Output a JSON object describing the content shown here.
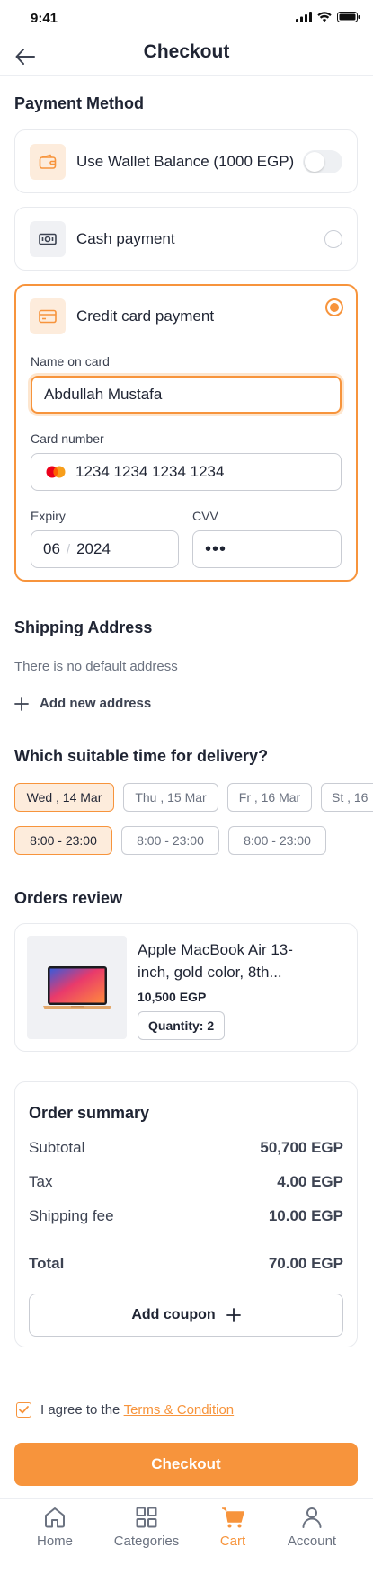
{
  "status": {
    "time": "9:41"
  },
  "header": {
    "title": "Checkout"
  },
  "payment": {
    "title": "Payment Method",
    "wallet_label": "Use Wallet Balance (1000 EGP)",
    "cash_label": "Cash payment",
    "credit_label": "Credit card payment",
    "name_label": "Name on card",
    "name_value": "Abdullah Mustafa",
    "card_label": "Card number",
    "card_value": "1234 1234 1234 1234",
    "expiry_label": "Expiry",
    "expiry_month": "06",
    "expiry_sep": "/",
    "expiry_year": "2024",
    "cvv_label": "CVV",
    "cvv_value": "•••"
  },
  "shipping": {
    "title": "Shipping Address",
    "empty_text": "There is no default address",
    "add_label": "Add new address"
  },
  "delivery": {
    "title": "Which suitable time for delivery?",
    "dates": [
      "Wed , 14 Mar",
      "Thu , 15 Mar",
      "Fr , 16 Mar",
      "St , 16"
    ],
    "times": [
      "8:00 - 23:00",
      "8:00 - 23:00",
      "8:00 - 23:00"
    ]
  },
  "orders": {
    "title": "Orders review",
    "product_name_1": "Apple MacBook Air 13-",
    "product_name_2": "inch, gold color, 8th...",
    "price": "10,500 EGP",
    "quantity": "Quantity: 2"
  },
  "summary": {
    "title": "Order summary",
    "subtotal_label": "Subtotal",
    "subtotal_value": "50,700 EGP",
    "tax_label": "Tax",
    "tax_value": "4.00 EGP",
    "shipping_label": "Shipping fee",
    "shipping_value": "10.00 EGP",
    "total_label": "Total",
    "total_value": "70.00 EGP",
    "coupon_label": "Add coupon"
  },
  "terms": {
    "prefix": "I agree to the ",
    "link": "Terms & Condition"
  },
  "checkout_label": "Checkout",
  "nav": {
    "home": "Home",
    "categories": "Categories",
    "cart": "Cart",
    "account": "Account"
  },
  "colors": {
    "accent": "#f7943c",
    "accent_light": "#fdecdc",
    "text": "#1f2433",
    "muted": "#6b7280"
  }
}
